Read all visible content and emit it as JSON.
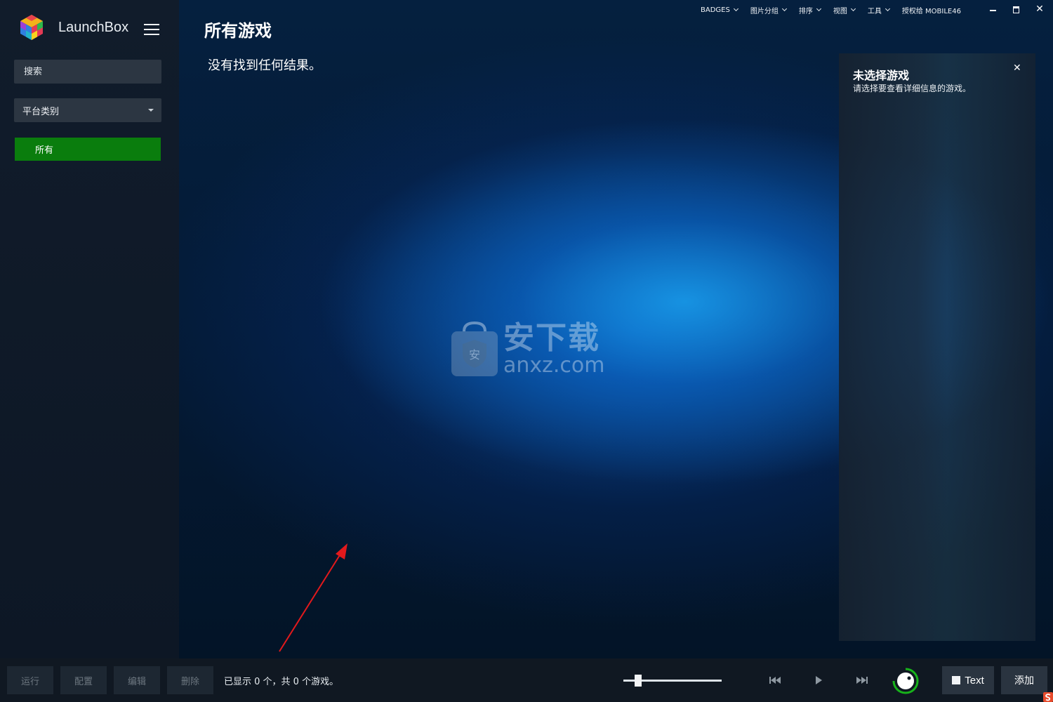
{
  "app": {
    "name": "LaunchBox"
  },
  "sidebar": {
    "search_placeholder": "搜索",
    "platform_select_label": "平台类别",
    "items": [
      {
        "label": "所有",
        "selected": true
      }
    ]
  },
  "topmenu": {
    "items": [
      {
        "label": "BADGES"
      },
      {
        "label": "图片分组"
      },
      {
        "label": "排序"
      },
      {
        "label": "视图"
      },
      {
        "label": "工具"
      }
    ],
    "license": "授权给 MOBILE46"
  },
  "main": {
    "title": "所有游戏",
    "no_results": "没有找到任何结果。"
  },
  "details": {
    "title": "未选择游戏",
    "subtitle": "请选择要查看详细信息的游戏。"
  },
  "watermark": {
    "cn": "安下载",
    "en": "anxz.com"
  },
  "bottombar": {
    "buttons": [
      {
        "label": "运行",
        "enabled": false
      },
      {
        "label": "配置",
        "enabled": false
      },
      {
        "label": "编辑",
        "enabled": false
      },
      {
        "label": "删除",
        "enabled": false
      }
    ],
    "status": "已显示 0 个，共 0 个游戏。",
    "text_toggle_label": "Text",
    "add_label": "添加",
    "zoom_level": 0.15
  },
  "colors": {
    "selected_item": "#0a7d0d",
    "annotation_arrow": "#e3191c",
    "accent_green": "#17b21a"
  }
}
